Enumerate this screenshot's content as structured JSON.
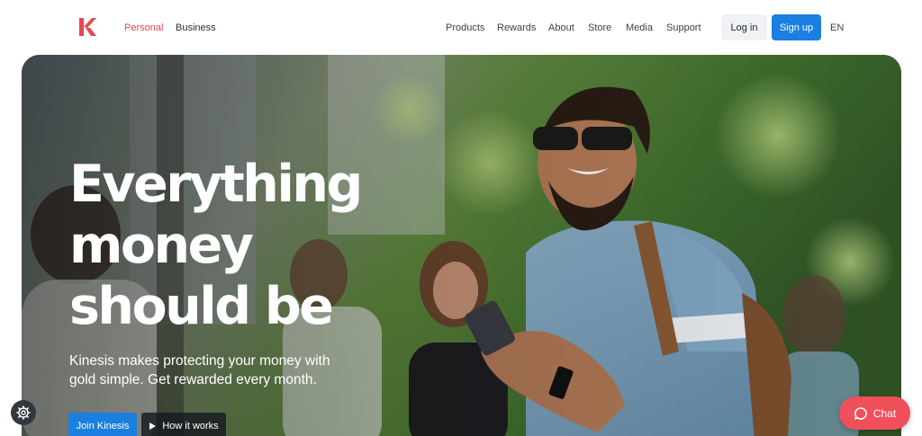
{
  "header": {
    "logo_icon": "kinesis-k-logo",
    "segments": [
      {
        "label": "Personal",
        "active": true
      },
      {
        "label": "Business",
        "active": false
      }
    ],
    "nav": [
      "Products",
      "Rewards",
      "About",
      "Store",
      "Media",
      "Support"
    ],
    "login_label": "Log in",
    "signup_label": "Sign up",
    "language": "EN"
  },
  "hero": {
    "title_lines": [
      "Everything",
      "money",
      "should be"
    ],
    "subtitle": "Kinesis makes protecting your money with gold simple. Get rewarded every month.",
    "primary_cta": "Join Kinesis",
    "secondary_cta": "How it works",
    "secondary_cta_icon": "play-icon"
  },
  "widgets": {
    "settings_icon": "gear-icon",
    "chat_label": "Chat",
    "chat_icon": "chat-bubble-icon"
  },
  "colors": {
    "brand_red": "#e8454f",
    "primary_blue": "#1a7fe0",
    "chat_red": "#f0505a"
  }
}
